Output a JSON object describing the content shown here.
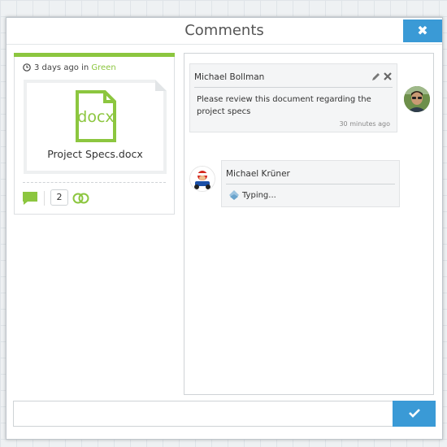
{
  "modal": {
    "title": "Comments",
    "close_icon": "close-icon"
  },
  "file_card": {
    "time_ago": "3 days ago in ",
    "group": "Green",
    "file_type_label": "docx",
    "file_name": "Project Specs.docx",
    "comment_count": "2",
    "accent_color": "#8cc63f"
  },
  "comments": [
    {
      "author": "Michael Bollman",
      "text": "Please review this document regarding the project specs",
      "time": "30 minutes ago",
      "icons": [
        "edit-icon",
        "delete-icon"
      ]
    },
    {
      "author": "Michael Krüner",
      "status": "Typing..."
    }
  ],
  "composer": {
    "placeholder": "",
    "send_icon": "check-icon",
    "button_color": "#3a9ad6"
  }
}
